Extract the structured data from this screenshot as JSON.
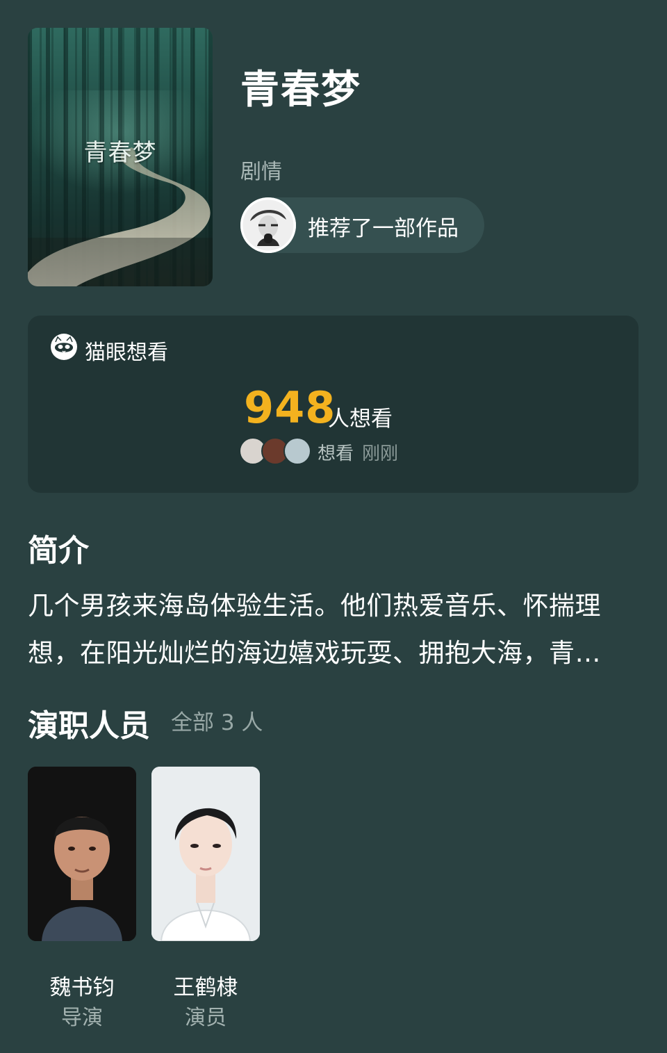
{
  "movie": {
    "title": "青春梦",
    "poster_text": "青春梦",
    "genre": "剧情"
  },
  "recommend": {
    "text": "推荐了一部作品",
    "avatar_icon": "user-avatar"
  },
  "want_card": {
    "brand": "猫眼想看",
    "brand_icon": "cat-face-icon",
    "count": "948",
    "count_unit": "人想看",
    "want_label": "想看",
    "want_time": "刚刚",
    "accent_color": "#f3b21f"
  },
  "intro": {
    "title": "简介",
    "text": "几个男孩来海岛体验生活。他们热爱音乐、怀揣理想，在阳光灿烂的海边嬉戏玩耍、拥抱大海，青…"
  },
  "cast": {
    "title": "演职人员",
    "count_text": "全部 3 人",
    "members": [
      {
        "name": "魏书钧",
        "role": "导演"
      },
      {
        "name": "王鹤棣",
        "role": "演员"
      }
    ]
  }
}
